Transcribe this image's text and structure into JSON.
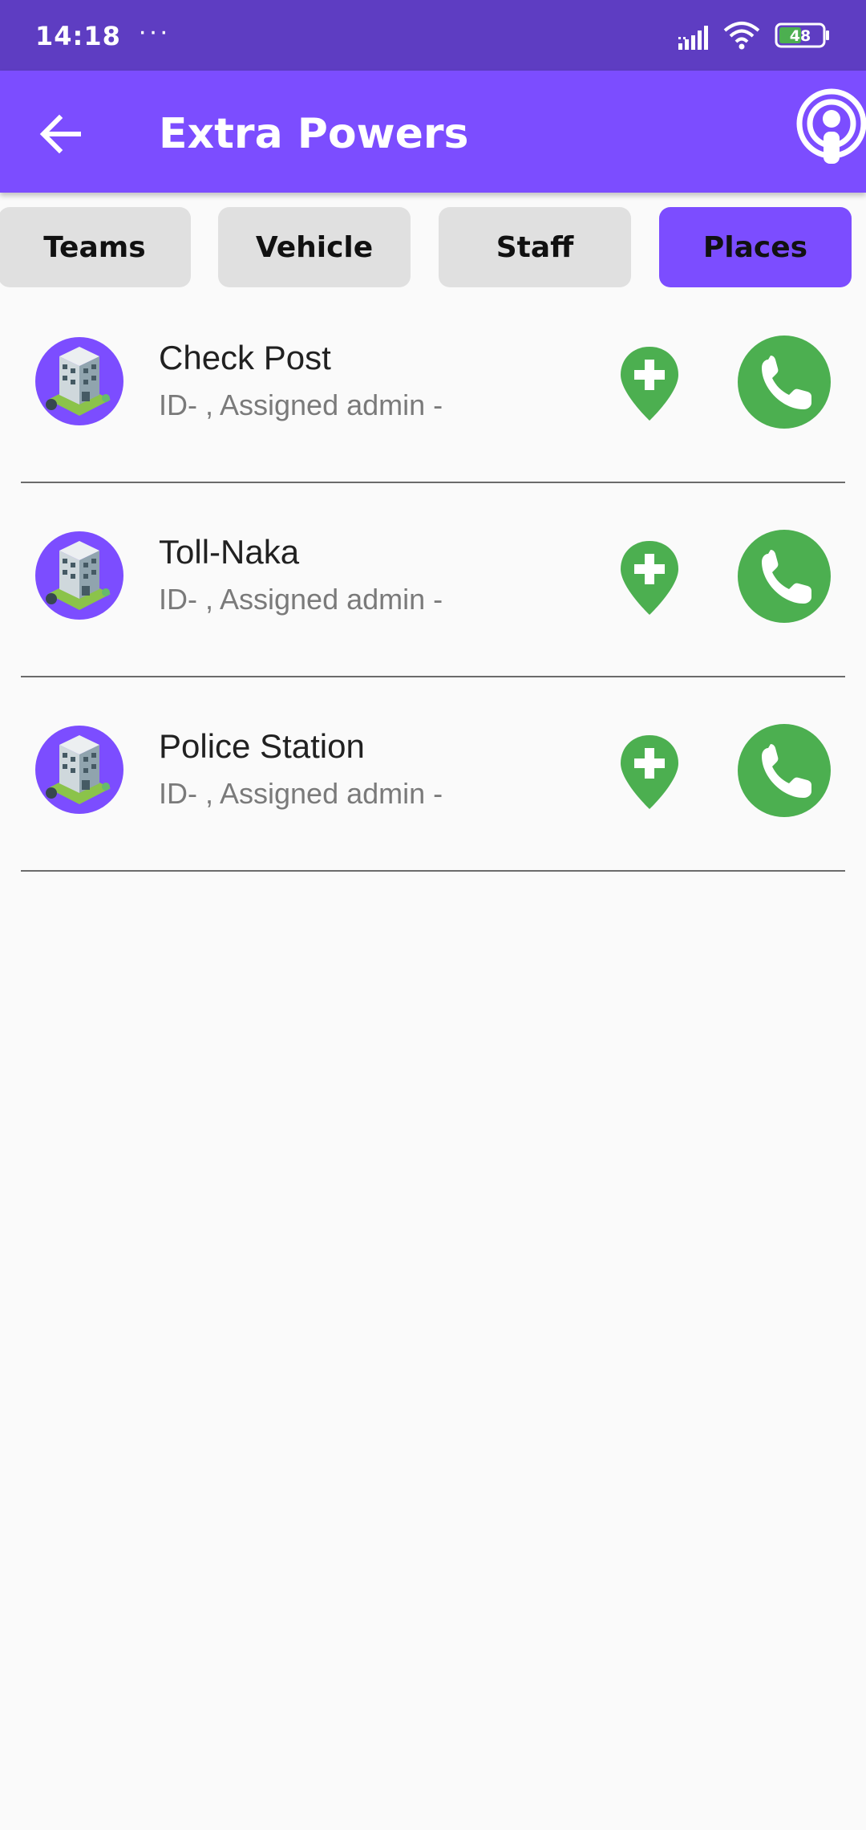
{
  "status_bar": {
    "time": "14:18",
    "dots": "···",
    "battery": "48"
  },
  "app_bar": {
    "title": "Extra Powers"
  },
  "tabs": [
    {
      "label": "Teams",
      "active": false
    },
    {
      "label": "Vehicle",
      "active": false
    },
    {
      "label": "Staff",
      "active": false
    },
    {
      "label": "Places",
      "active": true
    }
  ],
  "list": {
    "items": [
      {
        "title": "Check Post",
        "subtitle": "ID- , Assigned admin -"
      },
      {
        "title": "Toll-Naka",
        "subtitle": "ID- , Assigned admin -"
      },
      {
        "title": "Police Station",
        "subtitle": "ID- , Assigned admin -"
      }
    ]
  },
  "colors": {
    "status_bar": "#5e3dc2",
    "primary": "#7c4dff",
    "action_green": "#4caf50",
    "tab_inactive": "#e0e0e0",
    "background": "#fafafa"
  },
  "icons": {
    "back": "arrow-left-icon",
    "broadcast": "podcast-icon",
    "avatar": "building-icon",
    "location": "add-location-icon",
    "call": "phone-icon"
  }
}
